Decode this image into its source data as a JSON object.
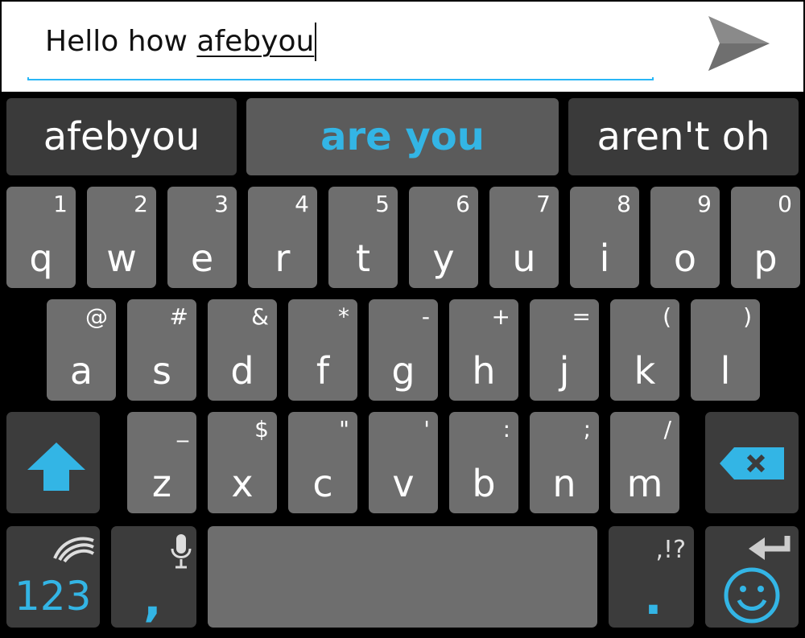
{
  "input": {
    "typed_text": "Hello how ",
    "composing_word": "afebyou"
  },
  "icons": {
    "send": "send-icon",
    "shift": "shift-arrow-icon",
    "backspace": "backspace-icon",
    "swype": "swiftkey-logo-icon",
    "mic": "microphone-icon",
    "enter": "enter-arrow-icon",
    "emoji": "smiley-icon"
  },
  "colors": {
    "accent": "#33b5e5",
    "key": "#6e6e6e",
    "key_dark": "#3c3c3c",
    "background": "#000000"
  },
  "suggestions": [
    {
      "label": "afebyou"
    },
    {
      "label": "are you"
    },
    {
      "label": "aren't oh"
    }
  ],
  "rows": {
    "row1": [
      {
        "main": "q",
        "alt": "1"
      },
      {
        "main": "w",
        "alt": "2"
      },
      {
        "main": "e",
        "alt": "3"
      },
      {
        "main": "r",
        "alt": "4"
      },
      {
        "main": "t",
        "alt": "5"
      },
      {
        "main": "y",
        "alt": "6"
      },
      {
        "main": "u",
        "alt": "7"
      },
      {
        "main": "i",
        "alt": "8"
      },
      {
        "main": "o",
        "alt": "9"
      },
      {
        "main": "p",
        "alt": "0"
      }
    ],
    "row2": [
      {
        "main": "a",
        "alt": "@"
      },
      {
        "main": "s",
        "alt": "#"
      },
      {
        "main": "d",
        "alt": "&"
      },
      {
        "main": "f",
        "alt": "*"
      },
      {
        "main": "g",
        "alt": "-"
      },
      {
        "main": "h",
        "alt": "+"
      },
      {
        "main": "j",
        "alt": "="
      },
      {
        "main": "k",
        "alt": "("
      },
      {
        "main": "l",
        "alt": ")"
      }
    ],
    "row3": [
      {
        "main": "z",
        "alt": "_"
      },
      {
        "main": "x",
        "alt": "$"
      },
      {
        "main": "c",
        "alt": "\""
      },
      {
        "main": "v",
        "alt": "'"
      },
      {
        "main": "b",
        "alt": ":"
      },
      {
        "main": "n",
        "alt": ";"
      },
      {
        "main": "m",
        "alt": "/"
      }
    ]
  },
  "bottom": {
    "numbers_label": "123",
    "comma_label": ",",
    "punct_label": ",!?",
    "period_label": "."
  }
}
